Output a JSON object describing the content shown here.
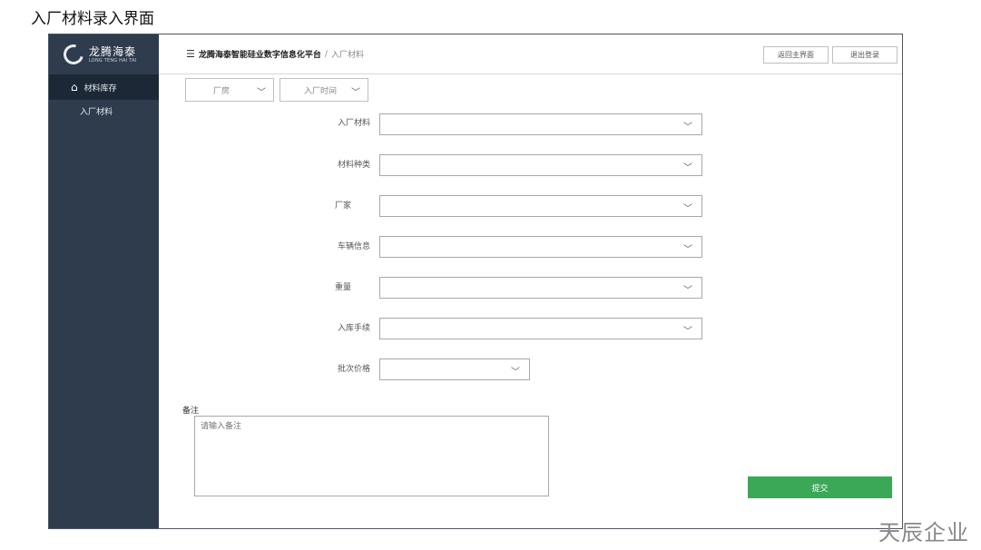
{
  "page_heading": "入厂材料录入界面",
  "watermark": "天辰企业",
  "logo": {
    "name_cn": "龙腾海泰",
    "name_en": "LONG TENG HAI TAI"
  },
  "sidebar": {
    "items": [
      {
        "label": "材料库存",
        "icon": "warehouse-icon",
        "active": true
      },
      {
        "label": "入厂材料",
        "active": false
      }
    ],
    "bg_color": "#2e3c4d"
  },
  "header": {
    "menu_icon": "menu-icon",
    "breadcrumb_main": "龙腾海泰智能硅业数字信息化平台",
    "breadcrumb_sep": "/",
    "breadcrumb_current": "入厂材料",
    "btn_home": "返回主界面",
    "btn_logout": "退出登录"
  },
  "filters": {
    "factory": "厂房",
    "time": "入厂时间"
  },
  "form": {
    "fields": [
      {
        "label": "入厂材料",
        "value": ""
      },
      {
        "label": "材料种类",
        "value": ""
      },
      {
        "label": "厂家",
        "value": ""
      },
      {
        "label": "车辆信息",
        "value": ""
      },
      {
        "label": "重量",
        "value": ""
      },
      {
        "label": "入库手续",
        "value": ""
      },
      {
        "label": "批次价格",
        "value": ""
      }
    ],
    "remark_label": "备注",
    "remark_placeholder": "请输入备注",
    "submit_label": "提交",
    "submit_color": "#3aa856"
  }
}
